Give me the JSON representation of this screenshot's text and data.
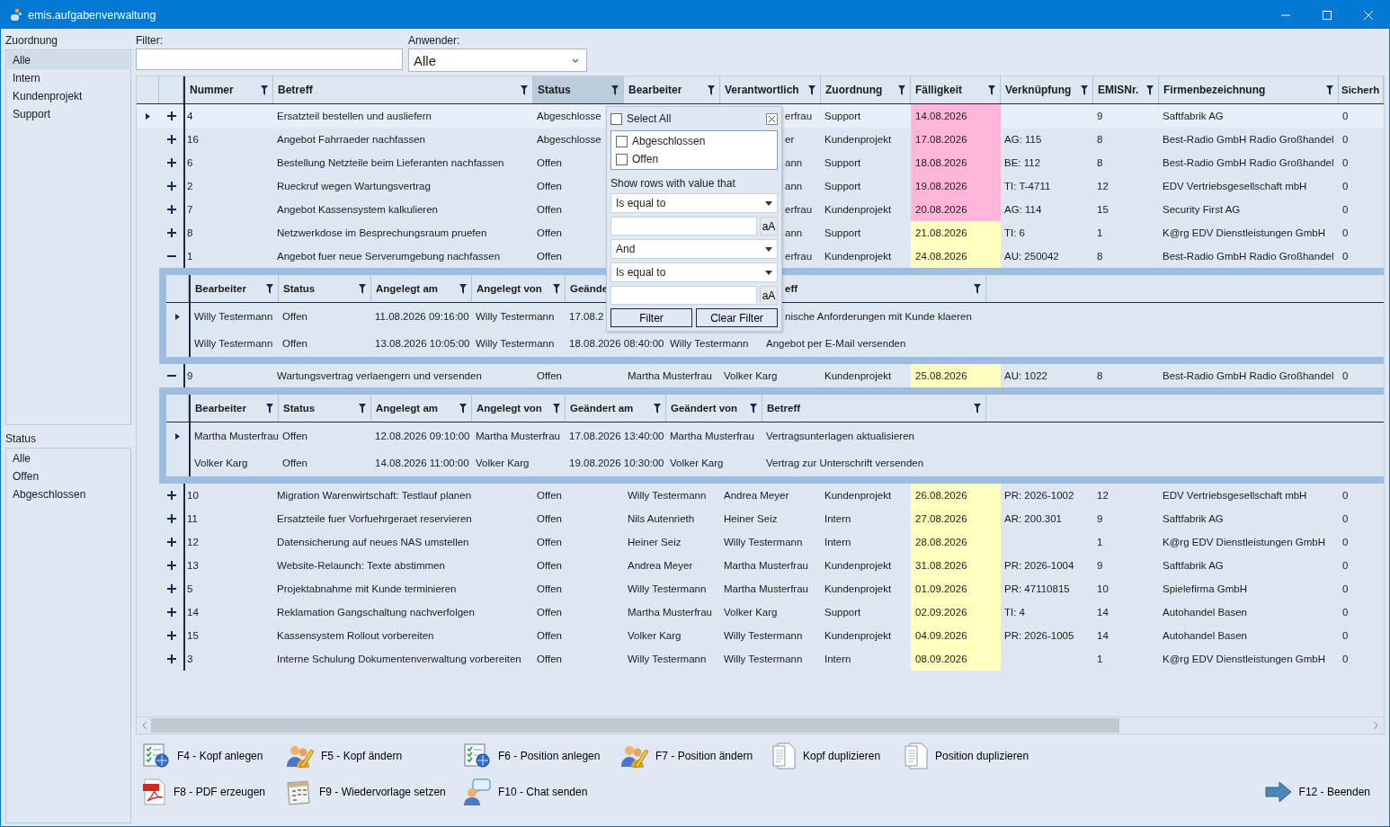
{
  "window": {
    "title": "emis.aufgabenverwaltung"
  },
  "zuordnung": {
    "label": "Zuordnung",
    "items": [
      {
        "label": "Alle",
        "selected": true
      },
      {
        "label": "Intern",
        "selected": false
      },
      {
        "label": "Kundenprojekt",
        "selected": false
      },
      {
        "label": "Support",
        "selected": false
      }
    ]
  },
  "status_list": {
    "label": "Status",
    "items": [
      {
        "label": "Alle",
        "selected": false
      },
      {
        "label": "Offen",
        "selected": false
      },
      {
        "label": "Abgeschlossen",
        "selected": false
      }
    ]
  },
  "filter": {
    "label": "Filter:"
  },
  "anwender": {
    "label": "Anwender:",
    "value": "Alle"
  },
  "grid": {
    "columns": [
      {
        "label": "Nummer",
        "filter_icon": true,
        "filter_open": false
      },
      {
        "label": "Betreff",
        "filter_icon": true,
        "filter_open": false
      },
      {
        "label": "Status",
        "filter_icon": true,
        "filter_open": true
      },
      {
        "label": "Bearbeiter",
        "filter_icon": true,
        "filter_open": false
      },
      {
        "label": "Verantwortlich",
        "filter_icon": true,
        "filter_open": false
      },
      {
        "label": "Zuordnung",
        "filter_icon": true,
        "filter_open": false
      },
      {
        "label": "Fälligkeit",
        "filter_icon": true,
        "filter_open": false
      },
      {
        "label": "Verknüpfung",
        "filter_icon": true,
        "filter_open": false
      },
      {
        "label": "EMISNr.",
        "filter_icon": true,
        "filter_open": false
      },
      {
        "label": "Firmenbezeichnung",
        "filter_icon": true,
        "filter_open": false
      },
      {
        "label": "Sicherh",
        "filter_icon": false,
        "filter_open": false
      }
    ],
    "rows": [
      {
        "selected": true,
        "expanded": false,
        "color": "#ffb6d9",
        "cells": [
          "4",
          "Ersatzteil bestellen und ausliefern",
          "Abgeschlosse",
          null,
          "erfrau",
          "Support",
          "14.08.2026",
          null,
          "9",
          "Saftfabrik AG",
          "0"
        ]
      },
      {
        "selected": false,
        "expanded": false,
        "color": "#ffb6d9",
        "cells": [
          "16",
          "Angebot Fahrraeder nachfassen",
          "Abgeschlosse",
          null,
          "er",
          "Kundenprojekt",
          "17.08.2026",
          "AG: 115",
          "8",
          "Best-Radio GmbH Radio Großhandel",
          "0"
        ]
      },
      {
        "selected": false,
        "expanded": false,
        "color": "#ffb6d9",
        "cells": [
          "6",
          "Bestellung Netzteile beim Lieferanten nachfassen",
          "Offen",
          null,
          "ann",
          "Support",
          "18.08.2026",
          "BE: 112",
          "8",
          "Best-Radio GmbH Radio Großhandel",
          "0"
        ]
      },
      {
        "selected": false,
        "expanded": false,
        "color": "#ffb6d9",
        "cells": [
          "2",
          "Rueckruf wegen Wartungsvertrag",
          "Offen",
          null,
          "ann",
          "Support",
          "19.08.2026",
          "TI: T-4711",
          "12",
          "EDV Vertriebsgesellschaft mbH",
          "0"
        ]
      },
      {
        "selected": false,
        "expanded": false,
        "color": "#ffb6d9",
        "cells": [
          "7",
          "Angebot Kassensystem kalkulieren",
          "Offen",
          null,
          "erfrau",
          "Kundenprojekt",
          "20.08.2026",
          "AG: 114",
          "15",
          "Security First AG",
          "0"
        ]
      },
      {
        "selected": false,
        "expanded": false,
        "color": "#ffffc0",
        "cells": [
          "8",
          "Netzwerkdose im Besprechungsraum pruefen",
          "Offen",
          null,
          "ann",
          "Support",
          "21.08.2026",
          "TI: 6",
          "1",
          "K@rg EDV Dienstleistungen GmbH",
          "0"
        ]
      },
      {
        "selected": false,
        "expanded": true,
        "color": "#ffffc0",
        "cells": [
          "1",
          "Angebot fuer neue Serverumgebung nachfassen",
          "Offen",
          null,
          "erfrau",
          "Kundenprojekt",
          "24.08.2026",
          "AU: 250042",
          "8",
          "Best-Radio GmbH Radio Großhandel",
          "0"
        ],
        "details": {
          "columns": [
            {
              "label": "Bearbeiter",
              "filter_icon": true
            },
            {
              "label": "Status",
              "filter_icon": true
            },
            {
              "label": "Angelegt am",
              "filter_icon": true
            },
            {
              "label": "Angelegt von",
              "filter_icon": true
            },
            {
              "label": "Geände",
              "filter_icon": false
            },
            null,
            {
              "label": "eff",
              "filter_icon": true
            }
          ],
          "rows": [
            {
              "selected": true,
              "cells": [
                "Willy Testermann",
                "Offen",
                "11.08.2026 09:16:00",
                "Willy Testermann",
                "17.08.2",
                null,
                "nische Anforderungen mit Kunde klaeren"
              ]
            },
            {
              "selected": false,
              "cells": [
                "Willy Testermann",
                "Offen",
                "13.08.2026 10:05:00",
                "Willy Testermann",
                "18.08.2026 08:40:00",
                "Willy Testermann",
                "Angebot per E-Mail versenden"
              ]
            }
          ]
        }
      },
      {
        "selected": false,
        "expanded": true,
        "color": "#ffffc0",
        "cells": [
          "9",
          "Wartungsvertrag verlaengern und versenden",
          "Offen",
          "Martha Musterfrau",
          "Volker Karg",
          "Kundenprojekt",
          "25.08.2026",
          "AU: 1022",
          "8",
          "Best-Radio GmbH Radio Großhandel",
          "0"
        ],
        "details": {
          "columns": [
            {
              "label": "Bearbeiter",
              "filter_icon": true
            },
            {
              "label": "Status",
              "filter_icon": true
            },
            {
              "label": "Angelegt am",
              "filter_icon": true
            },
            {
              "label": "Angelegt von",
              "filter_icon": true
            },
            {
              "label": "Geändert am",
              "filter_icon": true
            },
            {
              "label": "Geändert von",
              "filter_icon": true
            },
            {
              "label": "Betreff",
              "filter_icon": true
            }
          ],
          "rows": [
            {
              "selected": true,
              "cells": [
                "Martha Musterfrau",
                "Offen",
                "12.08.2026 09:10:00",
                "Martha Musterfrau",
                "17.08.2026 13:40:00",
                "Martha Musterfrau",
                "Vertragsunterlagen aktualisieren"
              ]
            },
            {
              "selected": false,
              "cells": [
                "Volker Karg",
                "Offen",
                "14.08.2026 11:00:00",
                "Volker Karg",
                "19.08.2026 10:30:00",
                "Volker Karg",
                "Vertrag zur Unterschrift versenden"
              ]
            }
          ]
        }
      },
      {
        "selected": false,
        "expanded": false,
        "color": "#ffffc0",
        "cells": [
          "10",
          "Migration Warenwirtschaft: Testlauf planen",
          "Offen",
          "Willy Testermann",
          "Andrea Meyer",
          "Kundenprojekt",
          "26.08.2026",
          "PR: 2026-1002",
          "12",
          "EDV Vertriebsgesellschaft mbH",
          "0"
        ]
      },
      {
        "selected": false,
        "expanded": false,
        "color": "#ffffc0",
        "cells": [
          "11",
          "Ersatzteile fuer Vorfuehrgeraet reservieren",
          "Offen",
          "Nils Autenrieth",
          "Heiner Seiz",
          "Intern",
          "27.08.2026",
          "AR: 200.301",
          "9",
          "Saftfabrik AG",
          "0"
        ]
      },
      {
        "selected": false,
        "expanded": false,
        "color": "#ffffc0",
        "cells": [
          "12",
          "Datensicherung auf neues NAS umstellen",
          "Offen",
          "Heiner Seiz",
          "Willy Testermann",
          "Intern",
          "28.08.2026",
          null,
          "1",
          "K@rg EDV Dienstleistungen GmbH",
          "0"
        ]
      },
      {
        "selected": false,
        "expanded": false,
        "color": "#ffffc0",
        "cells": [
          "13",
          "Website-Relaunch: Texte abstimmen",
          "Offen",
          "Andrea Meyer",
          "Martha Musterfrau",
          "Kundenprojekt",
          "31.08.2026",
          "PR: 2026-1004",
          "9",
          "Saftfabrik AG",
          "0"
        ]
      },
      {
        "selected": false,
        "expanded": false,
        "color": "#ffffc0",
        "cells": [
          "5",
          "Projektabnahme mit Kunde terminieren",
          "Offen",
          "Willy Testermann",
          "Martha Musterfrau",
          "Kundenprojekt",
          "01.09.2026",
          "PR: 47110815",
          "10",
          "Spielefirma GmbH",
          "0"
        ]
      },
      {
        "selected": false,
        "expanded": false,
        "color": "#ffffc0",
        "cells": [
          "14",
          "Reklamation Gangschaltung nachverfolgen",
          "Offen",
          "Martha Musterfrau",
          "Volker Karg",
          "Support",
          "02.09.2026",
          "TI: 4",
          "14",
          "Autohandel Basen",
          "0"
        ]
      },
      {
        "selected": false,
        "expanded": false,
        "color": "#ffffc0",
        "cells": [
          "15",
          "Kassensystem Rollout vorbereiten",
          "Offen",
          "Volker Karg",
          "Willy Testermann",
          "Kundenprojekt",
          "04.09.2026",
          "PR: 2026-1005",
          "14",
          "Autohandel Basen",
          "0"
        ]
      },
      {
        "selected": false,
        "expanded": false,
        "color": "#ffffc0",
        "cells": [
          "3",
          "Interne Schulung Dokumentenverwaltung vorbereiten",
          "Offen",
          "Willy Testermann",
          "Willy Testermann",
          "Intern",
          "08.09.2026",
          null,
          "1",
          "K@rg EDV Dienstleistungen GmbH",
          "0"
        ]
      }
    ]
  },
  "filter_popup": {
    "select_all": {
      "label": "Select All",
      "checked": false
    },
    "values": [
      {
        "label": "Abgeschlossen",
        "checked": false
      },
      {
        "label": "Offen",
        "checked": false
      }
    ],
    "prompt": "Show rows with value that",
    "condition_1": "Is equal to",
    "case_toggle_1": "aA",
    "operator": "And",
    "condition_2": "Is equal to",
    "case_toggle_2": "aA",
    "buttons": [
      "Filter",
      "Clear Filter"
    ]
  },
  "toolbar": {
    "rows": [
      [
        {
          "label": "F4 - Kopf anlegen",
          "kind": "new"
        },
        {
          "label": "F5 - Kopf ändern",
          "kind": "edit"
        },
        {
          "label": "F6 - Position anlegen",
          "kind": "new"
        },
        {
          "label": "F7 - Position ändern",
          "kind": "edit"
        },
        {
          "label": "Kopf duplizieren",
          "kind": "copy"
        },
        {
          "label": "Position duplizieren",
          "kind": "copy"
        }
      ],
      [
        {
          "label": "F8 - PDF erzeugen",
          "kind": "pdf"
        },
        {
          "label": "F9 - Wiedervorlage setzen",
          "kind": "calendar"
        },
        {
          "label": "F10 - Chat senden",
          "kind": "chat"
        }
      ]
    ],
    "exit": {
      "label": "F12 - Beenden",
      "kind": "exit"
    }
  }
}
